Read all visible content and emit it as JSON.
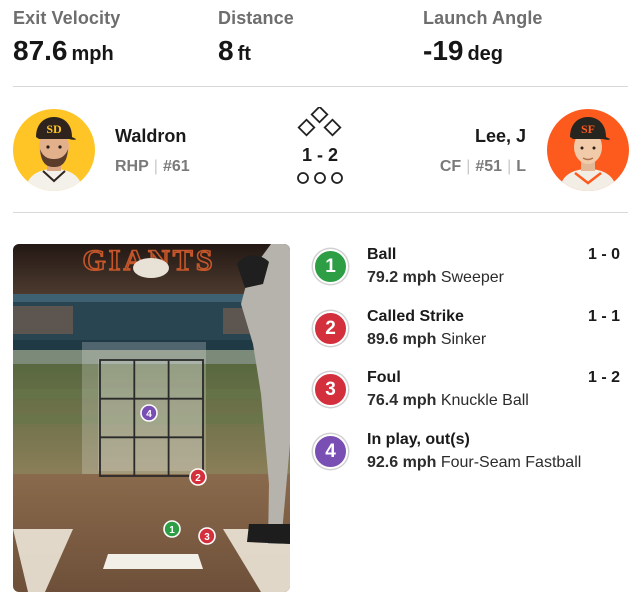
{
  "stats": [
    {
      "label": "Exit Velocity",
      "value": "87.6",
      "unit": "mph"
    },
    {
      "label": "Distance",
      "value": "8",
      "unit": "ft"
    },
    {
      "label": "Launch Angle",
      "value": "-19",
      "unit": "deg"
    }
  ],
  "pitcher": {
    "name": "Waldron",
    "hand": "RHP",
    "number": "#61",
    "cap_color": "#2f241d",
    "accent_color": "#ffc425"
  },
  "batter": {
    "name": "Lee, J",
    "position": "CF",
    "number": "#51",
    "bats": "L",
    "cap_color": "#27251f",
    "accent_color": "#fd5a1e"
  },
  "count": "1 - 2",
  "zone_logo": "GIANTS",
  "pitches": [
    {
      "number": "1",
      "result": "Ball",
      "count": "1 - 0",
      "speed": "79.2 mph",
      "type": "Sweeper",
      "color": "#2e9e45"
    },
    {
      "number": "2",
      "result": "Called Strike",
      "count": "1 - 1",
      "speed": "89.6 mph",
      "type": "Sinker",
      "color": "#d42f3c"
    },
    {
      "number": "3",
      "result": "Foul",
      "count": "1 - 2",
      "speed": "76.4 mph",
      "type": "Knuckle Ball",
      "color": "#d42f3c"
    },
    {
      "number": "4",
      "result": "In play, out(s)",
      "count": "",
      "speed": "92.6 mph",
      "type": "Four-Seam Fastball",
      "color": "#7a4fb3"
    }
  ]
}
